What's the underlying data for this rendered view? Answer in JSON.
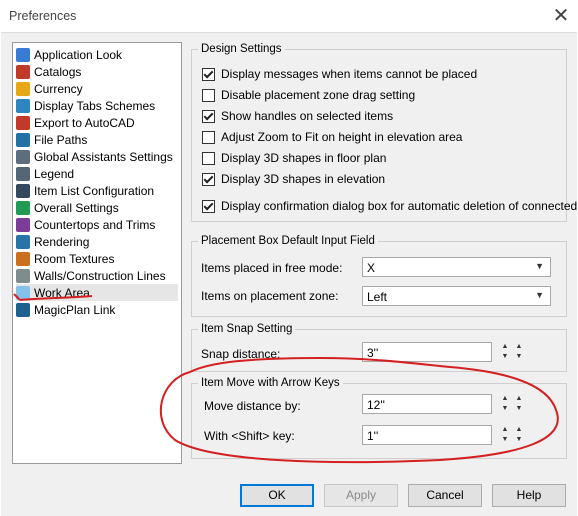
{
  "window": {
    "title": "Preferences"
  },
  "tree": {
    "items": [
      {
        "label": "Application Look",
        "icon": "application-look-icon",
        "color": "#3a7bd5"
      },
      {
        "label": "Catalogs",
        "icon": "catalogs-icon",
        "color": "#c0392b"
      },
      {
        "label": "Currency",
        "icon": "currency-icon",
        "color": "#e6a817"
      },
      {
        "label": "Display Tabs Schemes",
        "icon": "tabs-icon",
        "color": "#2e86c1"
      },
      {
        "label": "Export to AutoCAD",
        "icon": "autocad-icon",
        "color": "#c0392b"
      },
      {
        "label": "File Paths",
        "icon": "file-paths-icon",
        "color": "#2471a3"
      },
      {
        "label": "Global Assistants Settings",
        "icon": "assistants-icon",
        "color": "#5d6d7e"
      },
      {
        "label": "Legend",
        "icon": "legend-icon",
        "color": "#566573"
      },
      {
        "label": "Item List Configuration",
        "icon": "list-icon",
        "color": "#34495e"
      },
      {
        "label": "Overall Settings",
        "icon": "overall-settings-icon",
        "color": "#229954"
      },
      {
        "label": "Countertops and Trims",
        "icon": "countertops-icon",
        "color": "#7d3c98"
      },
      {
        "label": "Rendering",
        "icon": "rendering-icon",
        "color": "#2874a6"
      },
      {
        "label": "Room Textures",
        "icon": "textures-icon",
        "color": "#ca6f1e"
      },
      {
        "label": "Walls/Construction Lines",
        "icon": "walls-icon",
        "color": "#7f8c8d"
      },
      {
        "label": "Work Area",
        "icon": "work-area-icon",
        "color": "#85c1e9",
        "selected": true
      },
      {
        "label": "MagicPlan Link",
        "icon": "magicplan-icon",
        "color": "#1f618d"
      }
    ]
  },
  "design": {
    "legend": "Design Settings",
    "options": [
      {
        "label": "Display messages when items cannot be placed",
        "checked": true
      },
      {
        "label": "Disable placement zone drag setting",
        "checked": false
      },
      {
        "label": "Show handles on selected items",
        "checked": true
      },
      {
        "label": "Adjust Zoom to Fit on height in elevation area",
        "checked": false
      },
      {
        "label": "Display 3D shapes in floor plan",
        "checked": false
      },
      {
        "label": "Display 3D shapes in elevation",
        "checked": true
      },
      {
        "label": "Display confirmation dialog box for automatic deletion of connected it...",
        "checked": true
      }
    ]
  },
  "placement": {
    "legend": "Placement Box Default Input Field",
    "free_label": "Items placed in free mode:",
    "free_value": "X",
    "zone_label": "Items on placement zone:",
    "zone_value": "Left"
  },
  "snap": {
    "legend": "Item Snap Setting",
    "distance_label": "Snap distance:",
    "distance_value": "3''"
  },
  "move": {
    "legend": "Item Move with Arrow Keys",
    "distance_label": "Move distance by:",
    "distance_value": "12''",
    "shift_label": "With <Shift> key:",
    "shift_value": "1''"
  },
  "buttons": {
    "ok": "OK",
    "apply": "Apply",
    "cancel": "Cancel",
    "help": "Help"
  },
  "annotation_color": "#d42020"
}
